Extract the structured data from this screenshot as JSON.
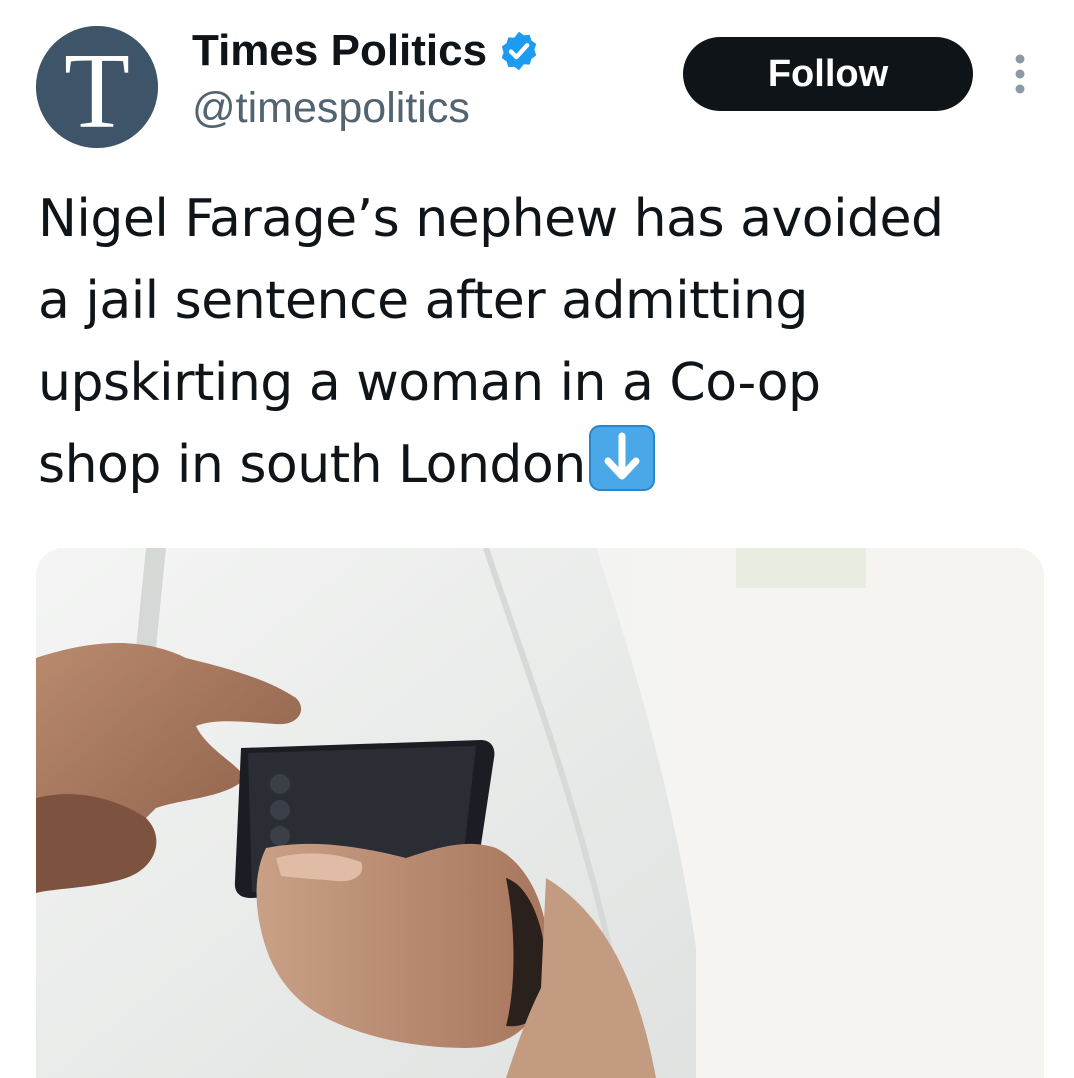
{
  "tweet": {
    "author": {
      "display_name": "Times Politics",
      "handle": "@timespolitics",
      "avatar_letter": "T",
      "verified": true,
      "avatar_color": "#3d5469",
      "verified_color": "#1d9bf0"
    },
    "follow_label": "Follow",
    "more_icon": "more-vertical-icon",
    "text": "Nigel Farage’s nephew has avoided\na jail sentence after admitting\nupskirting a woman in a Co-op\nshop in south London",
    "emoji": "down-arrow-emoji",
    "media": {
      "description_icon": "photo"
    }
  },
  "colors": {
    "text": "#0f1419",
    "secondary": "#536471",
    "button_bg": "#0f1419",
    "button_text": "#ffffff"
  }
}
